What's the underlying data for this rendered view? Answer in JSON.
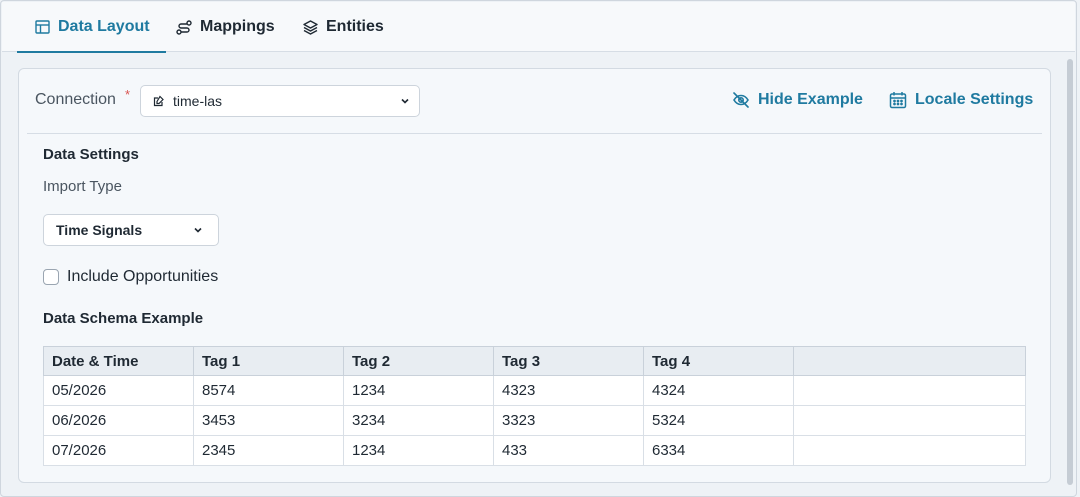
{
  "tabs": [
    {
      "label": "Data Layout",
      "icon": "table-icon",
      "active": true
    },
    {
      "label": "Mappings",
      "icon": "route-icon",
      "active": false
    },
    {
      "label": "Entities",
      "icon": "layers-icon",
      "active": false
    }
  ],
  "connection": {
    "label": "Connection",
    "required_mark": "*",
    "value": "time-las",
    "icon": "edit-icon"
  },
  "actions": {
    "hide_example": "Hide Example",
    "locale_settings": "Locale Settings"
  },
  "data_settings": {
    "title": "Data Settings",
    "import_type_label": "Import Type",
    "import_type_value": "Time Signals",
    "include_opportunities_label": "Include Opportunities",
    "include_opportunities_checked": false
  },
  "schema": {
    "title": "Data Schema Example",
    "columns": [
      "Date & Time",
      "Tag 1",
      "Tag 2",
      "Tag 3",
      "Tag 4",
      ""
    ],
    "rows": [
      [
        "05/2026",
        "8574",
        "1234",
        "4323",
        "4324",
        ""
      ],
      [
        "06/2026",
        "3453",
        "3234",
        "3323",
        "5324",
        ""
      ],
      [
        "07/2026",
        "2345",
        "1234",
        "433",
        "6334",
        ""
      ]
    ]
  },
  "colors": {
    "accent": "#1f7aa0",
    "required": "#d9534f"
  }
}
